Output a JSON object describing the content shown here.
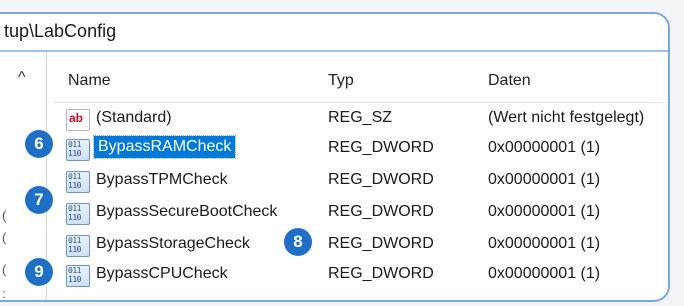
{
  "address_path": "tup\\LabConfig",
  "scroll_up_glyph": "^",
  "columns": {
    "name": "Name",
    "typ": "Typ",
    "daten": "Daten"
  },
  "rows": [
    {
      "name": "(Standard)",
      "type": "REG_SZ",
      "data": "(Wert nicht festgelegt)",
      "icon": "string-value-icon"
    },
    {
      "name": "BypassRAMCheck",
      "type": "REG_DWORD",
      "data": "0x00000001 (1)",
      "icon": "dword-value-icon",
      "selected": true
    },
    {
      "name": "BypassTPMCheck",
      "type": "REG_DWORD",
      "data": "0x00000001 (1)",
      "icon": "dword-value-icon"
    },
    {
      "name": "BypassSecureBootCheck",
      "type": "REG_DWORD",
      "data": "0x00000001 (1)",
      "icon": "dword-value-icon"
    },
    {
      "name": "BypassStorageCheck",
      "type": "REG_DWORD",
      "data": "0x00000001 (1)",
      "icon": "dword-value-icon"
    },
    {
      "name": "BypassCPUCheck",
      "type": "REG_DWORD",
      "data": "0x00000001 (1)",
      "icon": "dword-value-icon"
    }
  ],
  "badges": [
    "6",
    "7",
    "8",
    "9"
  ],
  "colors": {
    "badge": "#1f6fc6",
    "selection": "#0078d7",
    "frame_border": "#7ba7da"
  }
}
